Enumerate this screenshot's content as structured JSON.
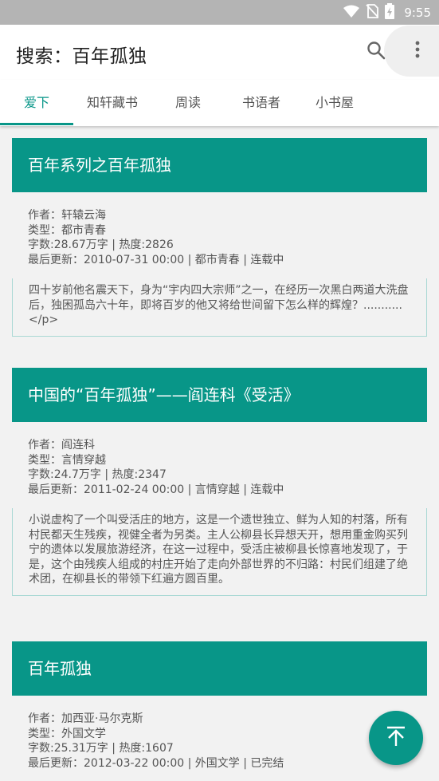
{
  "status_bar": {
    "time": "9:55",
    "icons": [
      "wifi-icon",
      "no-sim-icon",
      "battery-charging-icon"
    ]
  },
  "appbar": {
    "title": "搜索：百年孤独",
    "search_icon": "search-icon",
    "more_icon": "more-vert-icon"
  },
  "tabs": [
    {
      "label": "爱下",
      "active": true
    },
    {
      "label": "知轩藏书",
      "active": false
    },
    {
      "label": "周读",
      "active": false
    },
    {
      "label": "书语者",
      "active": false
    },
    {
      "label": "小书屋",
      "active": false
    }
  ],
  "books": [
    {
      "title": "百年系列之百年孤独",
      "author": "作者：轩辕云海",
      "type": "类型：都市青春",
      "stats": "字数:28.67万字 | 热度:2826",
      "updated": "最后更新：2010-07-31 00:00 | 都市青春 | 连载中",
      "description": "四十岁前他名震天下，身为“宇内四大宗师”之一，在经历一次黑白两道大洗盘后，独困孤岛六十年，即将百岁的他又将给世间留下怎么样的辉煌？........... </p>"
    },
    {
      "title": "中国的“百年孤独”——阎连科《受活》",
      "author": "作者：阎连科",
      "type": "类型：言情穿越",
      "stats": "字数:24.7万字 | 热度:2347",
      "updated": "最后更新：2011-02-24 00:00 | 言情穿越 | 连载中",
      "description": "小说虚构了一个叫受活庄的地方，这是一个遗世独立、鲜为人知的村落，所有村民都天生残疾，视健全者为另类。主人公柳县长异想天开，想用重金购买列宁的遗体以发展旅游经济，在这一过程中，受活庄被柳县长惊喜地发现了，于是，这个由残疾人组成的村庄开始了走向外部世界的不归路：村民们组建了绝术团，在柳县长的带领下红遍方圆百里。"
    },
    {
      "title": "百年孤独",
      "author": "作者：加西亚·马尔克斯",
      "type": "类型：外国文学",
      "stats": "字数:25.31万字 | 热度:1607",
      "updated": "最后更新：2012-03-22 00:00 | 外国文学 | 已完结"
    }
  ],
  "fab": {
    "icon": "scroll-to-top-icon"
  },
  "colors": {
    "primary": "#089688",
    "statusbar": "#b4b4b4",
    "background": "#f2f2f2"
  }
}
